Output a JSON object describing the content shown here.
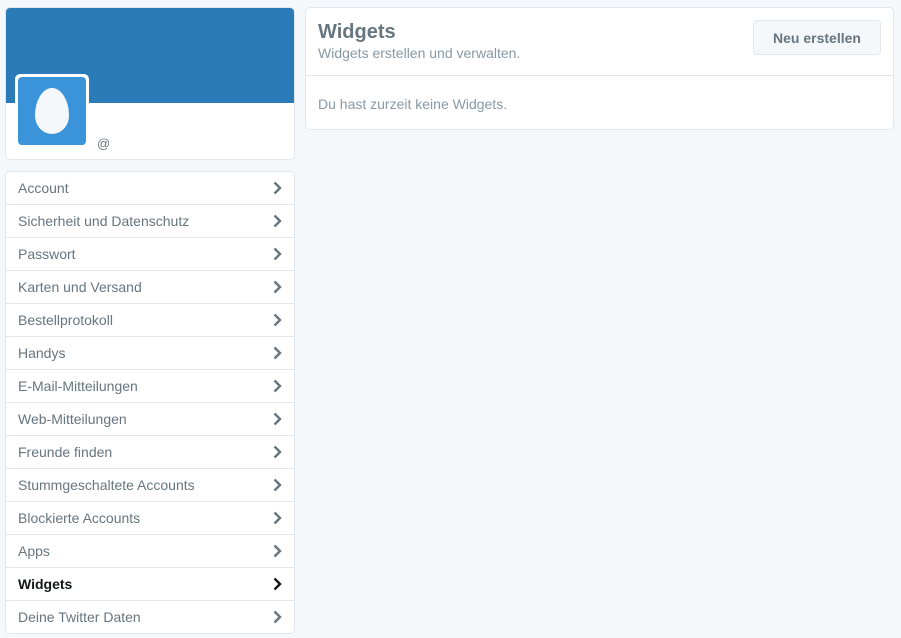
{
  "profile": {
    "banner_color": "#2b7bb9",
    "avatar_color": "#3b94d9",
    "avatar_icon": "egg-icon",
    "username": "@"
  },
  "sidebar": {
    "items": [
      {
        "label": "Account",
        "icon": "chevron-right-icon",
        "active": false
      },
      {
        "label": "Sicherheit und Datenschutz",
        "icon": "chevron-right-icon",
        "active": false
      },
      {
        "label": "Passwort",
        "icon": "chevron-right-icon",
        "active": false
      },
      {
        "label": "Karten und Versand",
        "icon": "chevron-right-icon",
        "active": false
      },
      {
        "label": "Bestellprotokoll",
        "icon": "chevron-right-icon",
        "active": false
      },
      {
        "label": "Handys",
        "icon": "chevron-right-icon",
        "active": false
      },
      {
        "label": "E-Mail-Mitteilungen",
        "icon": "chevron-right-icon",
        "active": false
      },
      {
        "label": "Web-Mitteilungen",
        "icon": "chevron-right-icon",
        "active": false
      },
      {
        "label": "Freunde finden",
        "icon": "chevron-right-icon",
        "active": false
      },
      {
        "label": "Stummgeschaltete Accounts",
        "icon": "chevron-right-icon",
        "active": false
      },
      {
        "label": "Blockierte Accounts",
        "icon": "chevron-right-icon",
        "active": false
      },
      {
        "label": "Apps",
        "icon": "chevron-right-icon",
        "active": false
      },
      {
        "label": "Widgets",
        "icon": "chevron-right-icon",
        "active": true
      },
      {
        "label": "Deine Twitter Daten",
        "icon": "chevron-right-icon",
        "active": false
      }
    ]
  },
  "main": {
    "title": "Widgets",
    "subtitle": "Widgets erstellen und verwalten.",
    "new_button_label": "Neu erstellen",
    "empty_message": "Du hast zurzeit keine Widgets."
  }
}
